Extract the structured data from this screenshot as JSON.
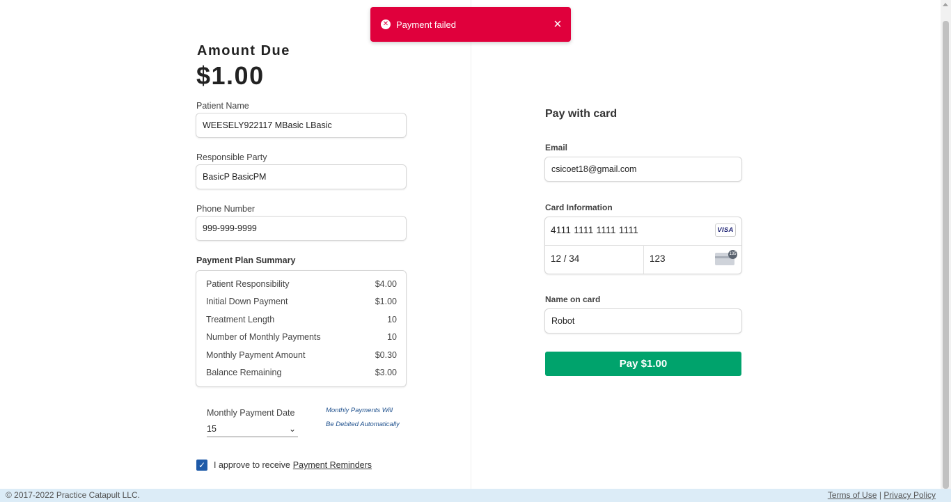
{
  "toast": {
    "message": "Payment failed",
    "icon": "error-circle-icon",
    "close_icon": "close-icon"
  },
  "amount": {
    "label": "Amount Due",
    "value": "$1.00"
  },
  "patient_name": {
    "label": "Patient Name",
    "value": "WEESELY922117 MBasic LBasic"
  },
  "responsible_party": {
    "label": "Responsible Party",
    "value": "BasicP BasicPM"
  },
  "phone_number": {
    "label": "Phone Number",
    "value": "999-999-9999"
  },
  "summary": {
    "title": "Payment Plan Summary",
    "rows": [
      {
        "label": "Patient Responsibility",
        "value": "$4.00"
      },
      {
        "label": "Initial Down Payment",
        "value": "$1.00"
      },
      {
        "label": "Treatment Length",
        "value": "10"
      },
      {
        "label": "Number of Monthly Payments",
        "value": "10"
      },
      {
        "label": "Monthly Payment Amount",
        "value": "$0.30"
      },
      {
        "label": "Balance Remaining",
        "value": "$3.00"
      }
    ]
  },
  "monthly_payment_date": {
    "label": "Monthly Payment Date",
    "value": "15"
  },
  "auto_note": {
    "line1": "Monthly Payments Will",
    "line2": "Be Debited Automatically"
  },
  "approve": {
    "checked": true,
    "text": "I approve to receive",
    "link": "Payment Reminders"
  },
  "pay_card": {
    "title": "Pay with card",
    "email": {
      "label": "Email",
      "value": "csicoet18@gmail.com"
    },
    "card_info": {
      "label": "Card Information",
      "number": "4111 1111 1111 1111",
      "brand": "VISA",
      "expiry": "12 / 34",
      "cvc": "123",
      "cvc_badge": "135"
    },
    "name_on_card": {
      "label": "Name on card",
      "value": "Robot"
    },
    "pay_button": "Pay $1.00"
  },
  "footer": {
    "copyright": "© 2017-2022 Practice Catapult LLC.",
    "terms": "Terms of Use",
    "separator": "|",
    "privacy": "Privacy Policy"
  },
  "colors": {
    "toast_bg": "#e0003c",
    "pay_button": "#00a36c",
    "checkbox": "#1e5aa8",
    "footer_bg": "#dcecf7",
    "note": "#1d4f8c"
  }
}
